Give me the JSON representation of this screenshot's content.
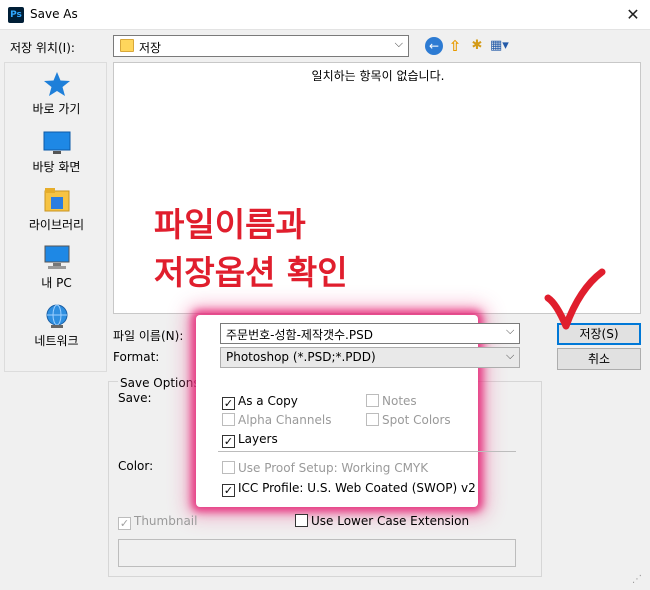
{
  "window": {
    "title": "Save As",
    "app_icon": "Ps"
  },
  "location": {
    "label": "저장 위치(I):",
    "folder": "저장"
  },
  "toolbar": {
    "back_icon": "back-arrow-icon",
    "up_icon": "up-folder-icon",
    "new_folder_icon": "new-folder-icon",
    "view_icon": "view-menu-icon"
  },
  "sidebar": {
    "items": [
      {
        "label": "바로 가기",
        "icon": "star-icon"
      },
      {
        "label": "바탕 화면",
        "icon": "desktop-icon"
      },
      {
        "label": "라이브러리",
        "icon": "library-icon"
      },
      {
        "label": "내 PC",
        "icon": "pc-icon"
      },
      {
        "label": "네트워크",
        "icon": "network-icon"
      }
    ]
  },
  "filelist": {
    "empty_message": "일치하는 항목이 없습니다."
  },
  "annotation": {
    "line1": "파일이름과",
    "line2": "저장옵션 확인",
    "color": "#e01e2d"
  },
  "filename": {
    "label": "파일 이름(N):",
    "value": "주문번호-성함-제작갯수.PSD"
  },
  "format": {
    "label": "Format:",
    "value": "Photoshop (*.PSD;*.PDD)"
  },
  "buttons": {
    "save": "저장(S)",
    "cancel": "취소"
  },
  "options": {
    "title": "Save Options",
    "save_label": "Save:",
    "color_label": "Color:",
    "checkboxes": {
      "as_a_copy": {
        "label": "As a Copy",
        "checked": true,
        "enabled": true
      },
      "notes": {
        "label": "Notes",
        "checked": false,
        "enabled": false
      },
      "alpha_channels": {
        "label": "Alpha Channels",
        "checked": false,
        "enabled": false
      },
      "spot_colors": {
        "label": "Spot Colors",
        "checked": false,
        "enabled": false
      },
      "layers": {
        "label": "Layers",
        "checked": true,
        "enabled": true
      },
      "use_proof_setup": {
        "label": "Use Proof Setup:  Working CMYK",
        "checked": false,
        "enabled": false
      },
      "icc_profile": {
        "label": "ICC Profile:  U.S. Web Coated (SWOP) v2",
        "checked": true,
        "enabled": true
      },
      "thumbnail": {
        "label": "Thumbnail",
        "checked": true,
        "enabled": false
      },
      "lower_case": {
        "label": "Use Lower Case Extension",
        "checked": false,
        "enabled": true
      }
    }
  },
  "colors": {
    "highlight_glow": "#e42878",
    "accent": "#0078d7"
  }
}
